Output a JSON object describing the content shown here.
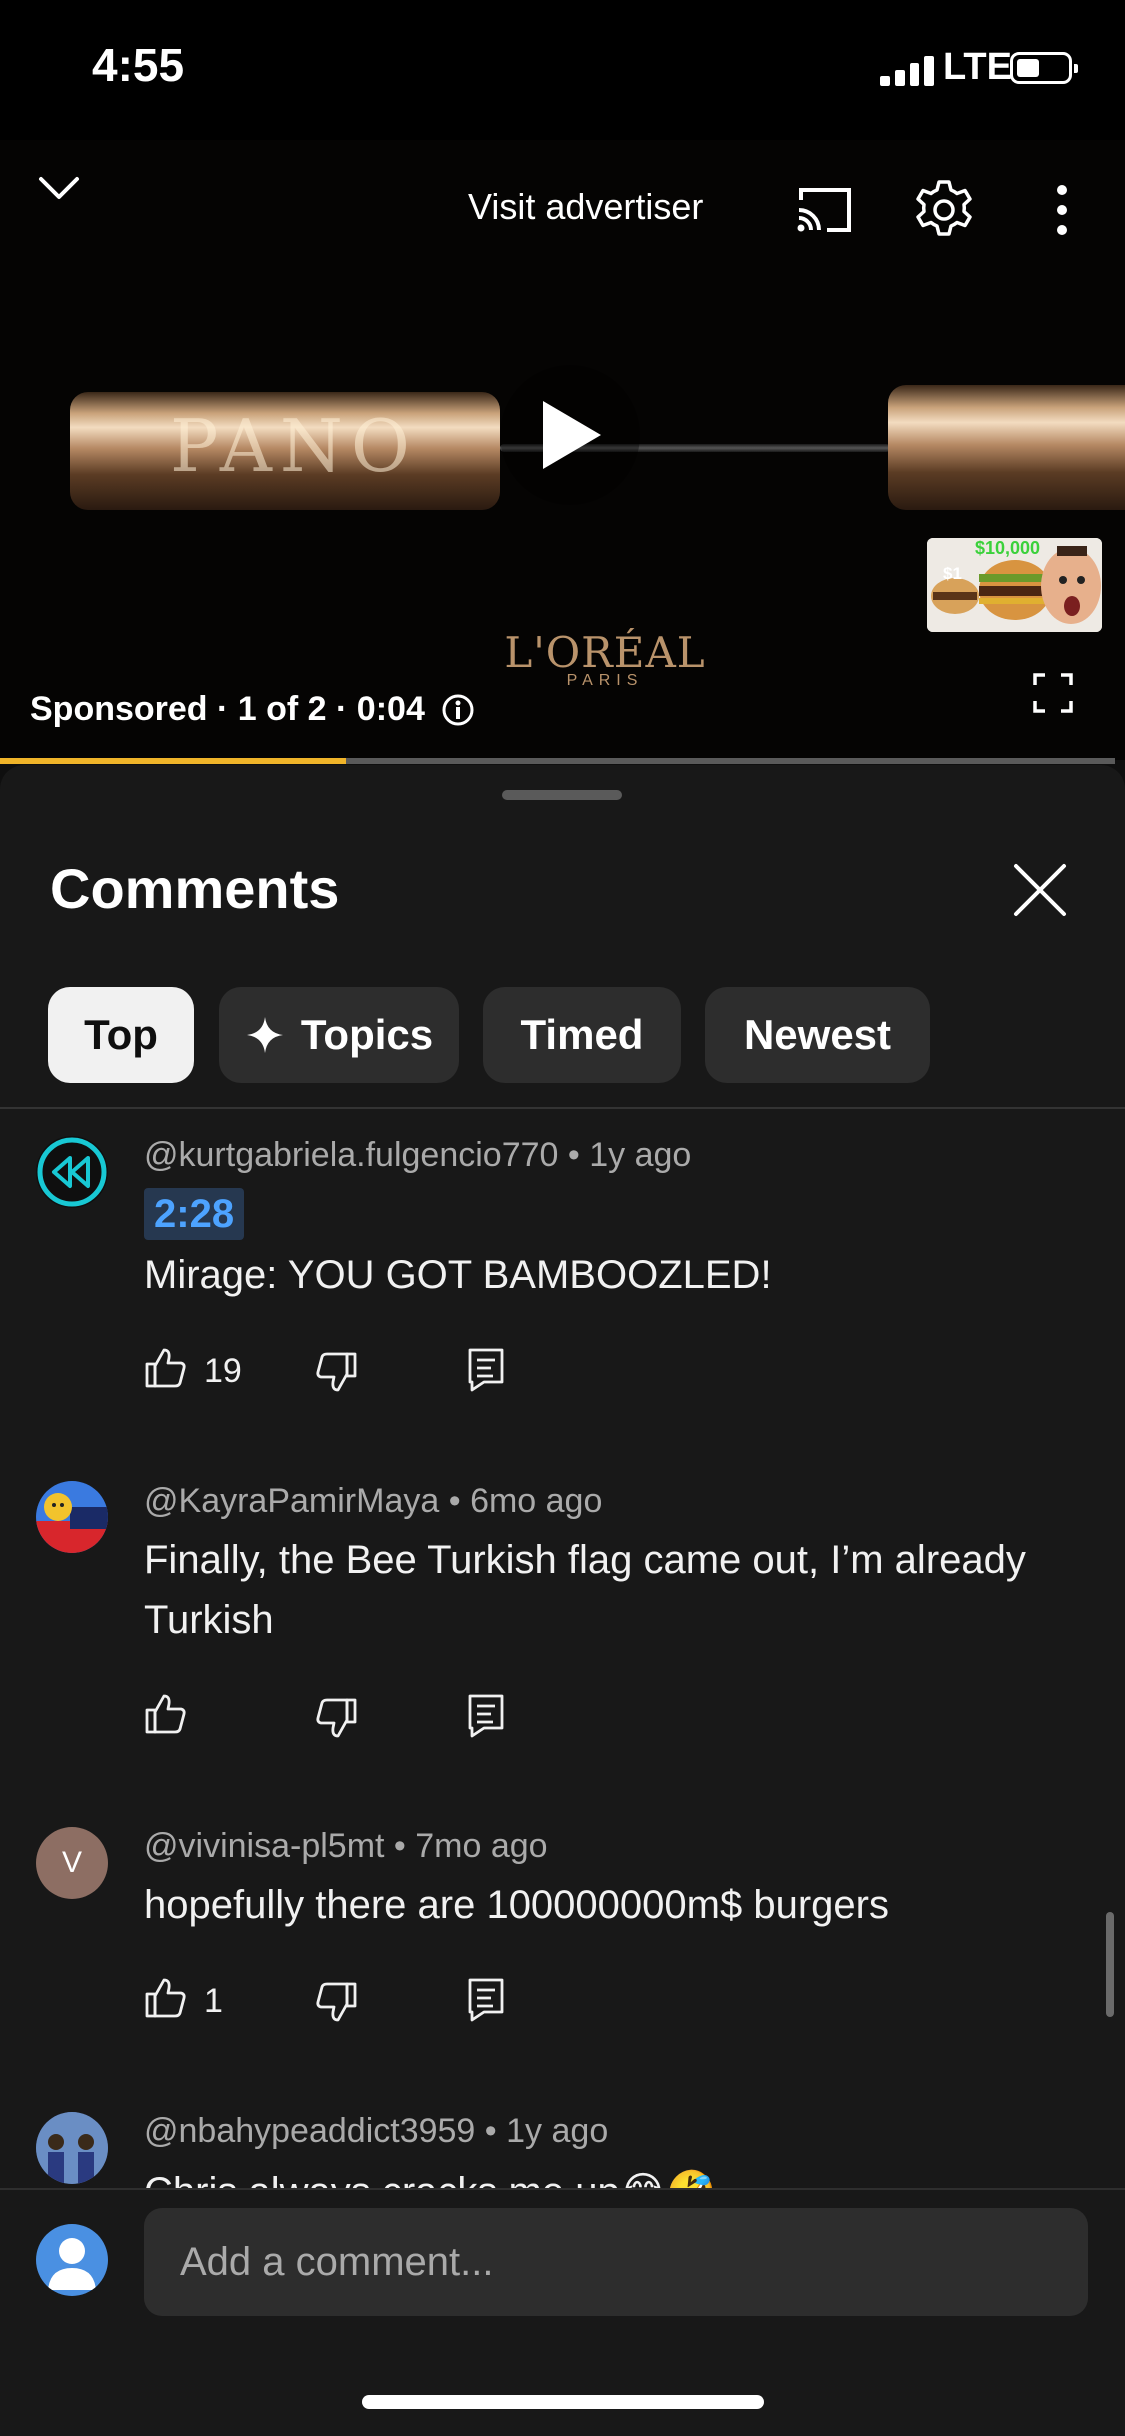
{
  "status_bar": {
    "time": "4:55",
    "network": "LTE"
  },
  "player": {
    "visit_advertiser": "Visit advertiser",
    "ad_info": "Sponsored · 1 of 2 · 0:04",
    "progress_fraction": 0.31,
    "brand_name": "L'ORÉAL",
    "brand_sub": "PARIS",
    "product_text": "PANO",
    "thumb_price_small": "$1",
    "thumb_price_big": "$10,000"
  },
  "comments": {
    "title": "Comments",
    "chips": [
      "Top",
      "Topics",
      "Timed",
      "Newest"
    ],
    "active_chip": "Top",
    "items": [
      {
        "author": "@kurtgabriela.fulgencio770",
        "age": "1y ago",
        "timestamp": "2:28",
        "text": "Mirage: YOU GOT BAMBOOZLED!",
        "likes": "19"
      },
      {
        "author": "@KayraPamirMaya",
        "age": "6mo ago",
        "text": "Finally, the Bee Turkish flag came out, I’m already Turkish",
        "likes": ""
      },
      {
        "author": "@vivinisa-pl5mt",
        "age": "7mo ago",
        "avatar_letter": "V",
        "text": "hopefully there are 100000000m$ burgers",
        "likes": "1"
      },
      {
        "author": "@nbahypeaddict3959",
        "age": "1y ago",
        "text": "Chris always cracks me up😂🤣"
      }
    ],
    "input_placeholder": "Add a comment..."
  },
  "colors": {
    "background": "#0f0f0f",
    "sheet": "#181818",
    "progress": "#f0b429",
    "timestamp_link": "#4da3ff",
    "chip": "#2d2d2d"
  }
}
